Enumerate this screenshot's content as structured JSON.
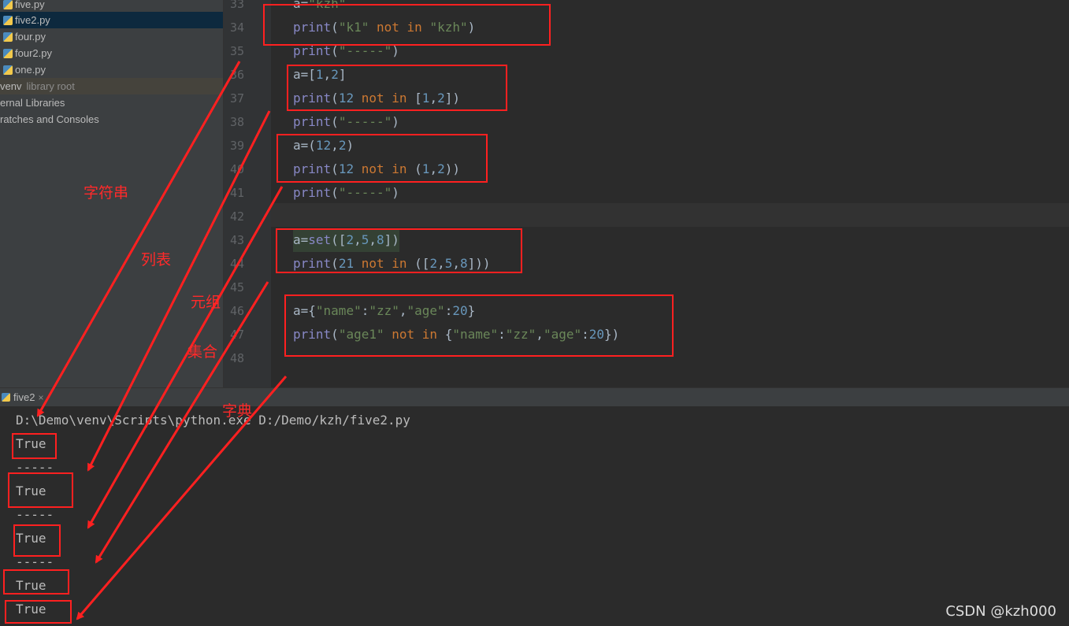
{
  "project_tree": {
    "items": [
      {
        "label": "five.py"
      },
      {
        "label": "five2.py"
      },
      {
        "label": "four.py"
      },
      {
        "label": "four2.py"
      },
      {
        "label": "one.py"
      },
      {
        "label": "venv",
        "suffix": "library root"
      },
      {
        "label": "ernal Libraries"
      },
      {
        "label": "ratches and Consoles"
      }
    ]
  },
  "editor": {
    "lines": [
      {
        "n": "33",
        "t": "a=\"kzh\""
      },
      {
        "n": "34",
        "t": "print(\"k1\" not in \"kzh\")"
      },
      {
        "n": "35",
        "t": "print(\"-----\")"
      },
      {
        "n": "36",
        "t": "a=[1,2]"
      },
      {
        "n": "37",
        "t": "print(12 not in [1,2])"
      },
      {
        "n": "38",
        "t": "print(\"-----\")"
      },
      {
        "n": "39",
        "t": "a=(12,2)"
      },
      {
        "n": "40",
        "t": "print(12 not in (1,2))"
      },
      {
        "n": "41",
        "t": "print(\"-----\")"
      },
      {
        "n": "42",
        "t": ""
      },
      {
        "n": "43",
        "t": "a=set([2,5,8])"
      },
      {
        "n": "44",
        "t": "print(21 not in ([2,5,8]))"
      },
      {
        "n": "45",
        "t": ""
      },
      {
        "n": "46",
        "t": "a={\"name\":\"zz\",\"age\":20}"
      },
      {
        "n": "47",
        "t": "print(\"age1\" not in {\"name\":\"zz\",\"age\":20})"
      },
      {
        "n": "48",
        "t": ""
      }
    ]
  },
  "run_panel": {
    "tab_label": "five2",
    "close_glyph": "×",
    "output": [
      "D:\\Demo\\venv\\Scripts\\python.exe D:/Demo/kzh/five2.py",
      "True",
      "-----",
      "True",
      "-----",
      "True",
      "-----",
      "True",
      "True"
    ]
  },
  "annotations": {
    "labels": [
      "字符串",
      "列表",
      "元组",
      "集合",
      "字典"
    ],
    "color": "#ff2020"
  },
  "watermark": "CSDN @kzh000"
}
